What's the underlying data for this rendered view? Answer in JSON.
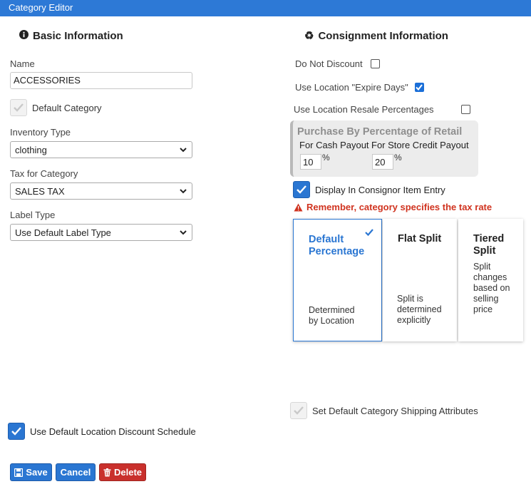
{
  "window": {
    "title": "Category Editor"
  },
  "basic": {
    "heading": "Basic Information",
    "name_label": "Name",
    "name_value": "ACCESSORIES",
    "default_category_label": "Default Category",
    "default_category_checked": true,
    "inventory_type_label": "Inventory Type",
    "inventory_type_value": "clothing",
    "tax_label": "Tax for Category",
    "tax_value": "SALES TAX",
    "label_type_label": "Label Type",
    "label_type_value": "Use Default Label Type"
  },
  "consignment": {
    "heading": "Consignment Information",
    "do_not_discount_label": "Do Not Discount",
    "do_not_discount_checked": false,
    "expire_days_label": "Use Location \"Expire Days\"",
    "expire_days_checked": true,
    "resale_pct_label": "Use Location Resale Percentages",
    "resale_pct_checked": false,
    "panel_title": "Purchase By Percentage of Retail",
    "cash_label": "For Cash Payout",
    "cash_value": "10",
    "credit_label": "For Store Credit Payout",
    "credit_value": "20",
    "percent_symbol": "%",
    "display_item_entry_label": "Display In Consignor Item Entry",
    "display_item_entry_checked": true,
    "warning_text": "Remember, category specifies the tax rate",
    "split_cards": [
      {
        "title": "Default Percentage",
        "desc": "Determined by Location",
        "selected": true
      },
      {
        "title": "Flat Split",
        "desc": "Split is determined explicitly",
        "selected": false
      },
      {
        "title": "Tiered Split",
        "desc": "Split changes based on selling price",
        "selected": false
      }
    ],
    "shipping_label": "Set Default Category Shipping Attributes",
    "shipping_checked": true
  },
  "footer": {
    "discount_schedule_label": "Use Default Location Discount Schedule",
    "discount_schedule_checked": true,
    "save_label": "Save",
    "cancel_label": "Cancel",
    "delete_label": "Delete"
  },
  "colors": {
    "titlebar": "#2d79d6",
    "primary_button": "#2a76d2",
    "danger_button": "#c9302c",
    "warning_text": "#d0331f"
  },
  "icons": [
    "info-circle-icon",
    "recycle-icon",
    "checkmark-icon",
    "chevron-down-icon",
    "warning-triangle-icon",
    "save-floppy-icon",
    "trash-icon"
  ]
}
